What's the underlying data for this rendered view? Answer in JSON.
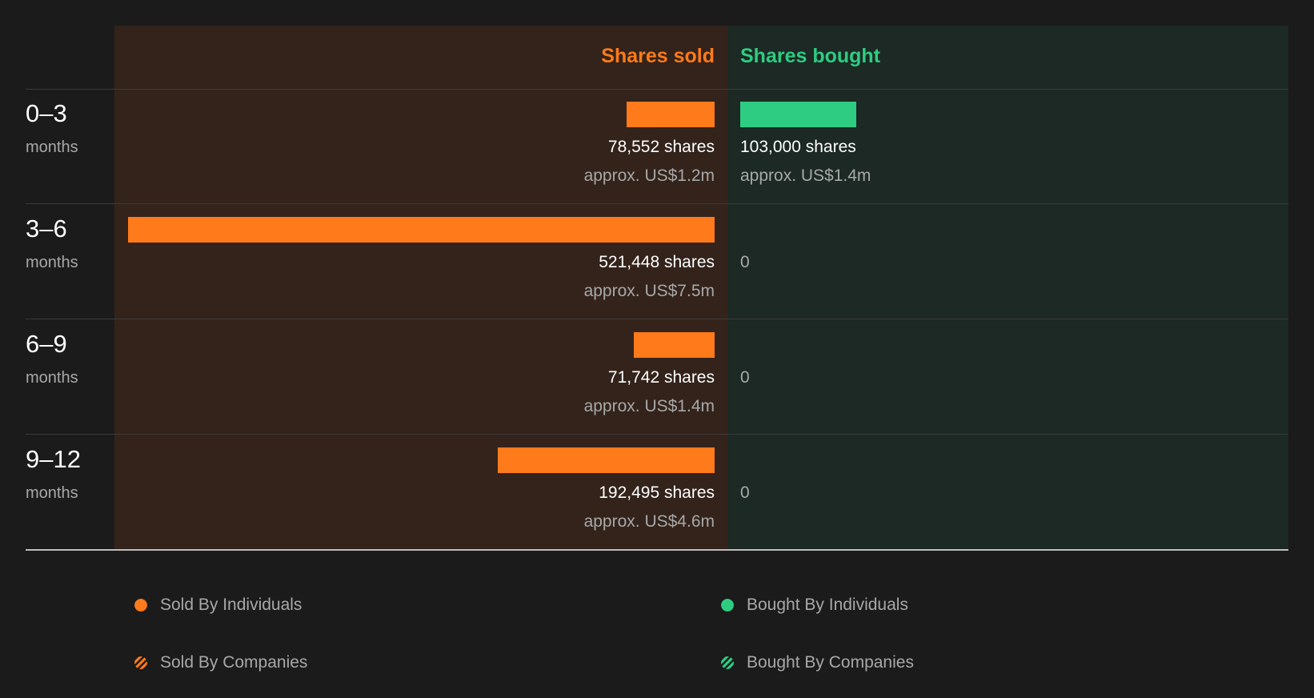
{
  "colors": {
    "background": "#1b1b1b",
    "sold_panel": "#33231b",
    "bought_panel": "#1c2924",
    "sold": "#ff7a1a",
    "bought": "#2ecc82",
    "muted_text": "#a8a8a8"
  },
  "chart_data": {
    "type": "bar",
    "layout": "diverging-horizontal",
    "column_headers": {
      "sold": "Shares sold",
      "bought": "Shares bought"
    },
    "categories": [
      "0-3 months",
      "3-6 months",
      "6-9 months",
      "9-12 months"
    ],
    "series": [
      {
        "name": "Shares sold",
        "values": [
          78552,
          521448,
          71742,
          192495
        ]
      },
      {
        "name": "Shares bought",
        "values": [
          103000,
          0,
          0,
          0
        ]
      }
    ],
    "rows": [
      {
        "range": "0–3",
        "unit": "months",
        "sold": 78552,
        "sold_label": "78,552 shares",
        "sold_value_label": "approx. US$1.2m",
        "bought": 103000,
        "bought_label": "103,000 shares",
        "bought_value_label": "approx. US$1.4m"
      },
      {
        "range": "3–6",
        "unit": "months",
        "sold": 521448,
        "sold_label": "521,448 shares",
        "sold_value_label": "approx. US$7.5m",
        "bought": 0,
        "bought_label": "0",
        "bought_value_label": ""
      },
      {
        "range": "6–9",
        "unit": "months",
        "sold": 71742,
        "sold_label": "71,742 shares",
        "sold_value_label": "approx. US$1.4m",
        "bought": 0,
        "bought_label": "0",
        "bought_value_label": ""
      },
      {
        "range": "9–12",
        "unit": "months",
        "sold": 192495,
        "sold_label": "192,495 shares",
        "sold_value_label": "approx. US$4.6m",
        "bought": 0,
        "bought_label": "0",
        "bought_value_label": ""
      }
    ],
    "legend": [
      {
        "label": "Sold By Individuals",
        "icon": "solid-dot",
        "color": "#ff7a1a"
      },
      {
        "label": "Bought By Individuals",
        "icon": "solid-dot",
        "color": "#2ecc82"
      },
      {
        "label": "Sold By Companies",
        "icon": "striped-dot",
        "color": "#ff7a1a"
      },
      {
        "label": "Bought By Companies",
        "icon": "striped-dot",
        "color": "#2ecc82"
      }
    ],
    "legend_placement": "bottom"
  }
}
